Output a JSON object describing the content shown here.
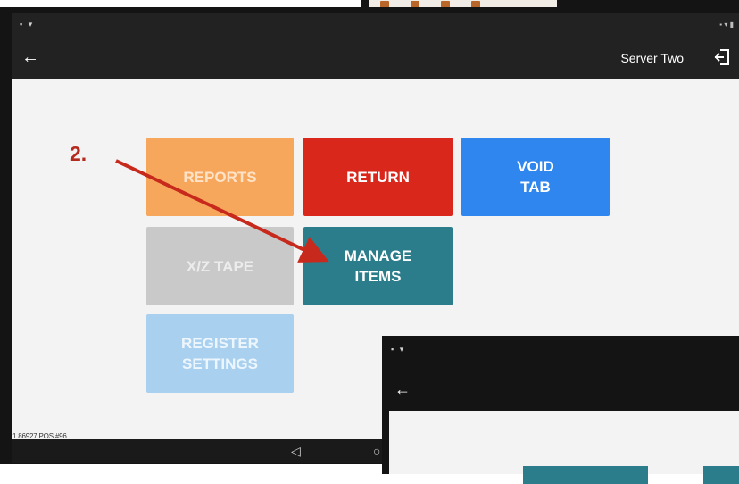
{
  "appbar": {
    "user_name": "Server Two"
  },
  "buttons": {
    "reports": "REPORTS",
    "return": "RETURN",
    "void_tab": "VOID\nTAB",
    "xz_tape": "X/Z TAPE",
    "manage_items": "MANAGE\nITEMS",
    "register_settings": "REGISTER\nSETTINGS"
  },
  "footer": {
    "version": "1.86927 POS #96"
  },
  "annotation": {
    "step": "2."
  },
  "colors": {
    "reports": "#f7a75c",
    "return": "#d9271c",
    "void_tab": "#2f86ee",
    "xz_tape": "#c9c9c9",
    "manage_items": "#2c7d8b",
    "register_settings": "#a9d0ef",
    "annotation": "#b52a1e"
  },
  "icons": {
    "back": "arrow-left-icon",
    "logout": "logout-icon",
    "nav_back": "triangle-back-icon",
    "nav_home": "circle-home-icon"
  }
}
